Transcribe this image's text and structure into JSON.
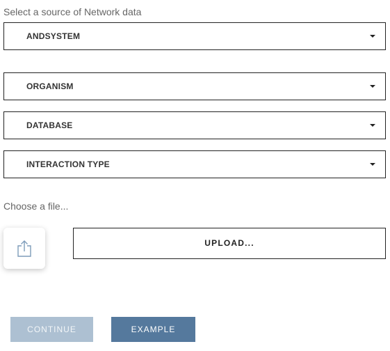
{
  "source": {
    "label": "Select a source of Network data",
    "dropdowns": [
      {
        "label": "ANDSYSTEM"
      },
      {
        "label": "ORGANISM"
      },
      {
        "label": "DATABASE"
      },
      {
        "label": "INTERACTION TYPE"
      }
    ]
  },
  "file": {
    "label": "Choose a file...",
    "upload_label": "UPLOAD...",
    "upload_icon": "share-upload-icon"
  },
  "actions": {
    "continue_label": "CONTINUE",
    "continue_state": "disabled",
    "example_label": "EXAMPLE"
  },
  "colors": {
    "continue_bg": "#adc0d2",
    "example_bg": "#55799d",
    "border": "#222222"
  }
}
